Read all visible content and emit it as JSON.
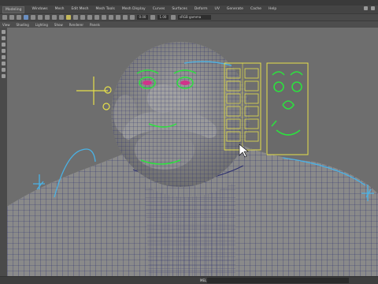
{
  "menu": {
    "items": [
      "Modeling",
      "Windows",
      "Mesh",
      "Edit Mesh",
      "Mesh Tools",
      "Mesh Display",
      "Curves",
      "Surfaces",
      "Deform",
      "UV",
      "Generate",
      "Cache",
      "Help"
    ]
  },
  "status": {
    "field_a": "0.00",
    "field_b": "1.00",
    "view_transform": "sRGB gamma"
  },
  "panel_menu": {
    "items": [
      "View",
      "Shading",
      "Lighting",
      "Show",
      "Renderer",
      "Panels"
    ]
  },
  "footer": {
    "mel_label": "MEL"
  },
  "colors": {
    "viewport_bg": "#6e6e6e",
    "mesh_fill": "#8c8c8c",
    "wire": "#2c2f6e",
    "control_green": "#2de03f",
    "control_yellow": "#e6e04a",
    "control_cyan": "#4ab2e6"
  },
  "icons": [
    "select-tool-icon",
    "lasso-icon",
    "paint-icon",
    "move-icon",
    "rotate-icon",
    "scale-icon"
  ]
}
